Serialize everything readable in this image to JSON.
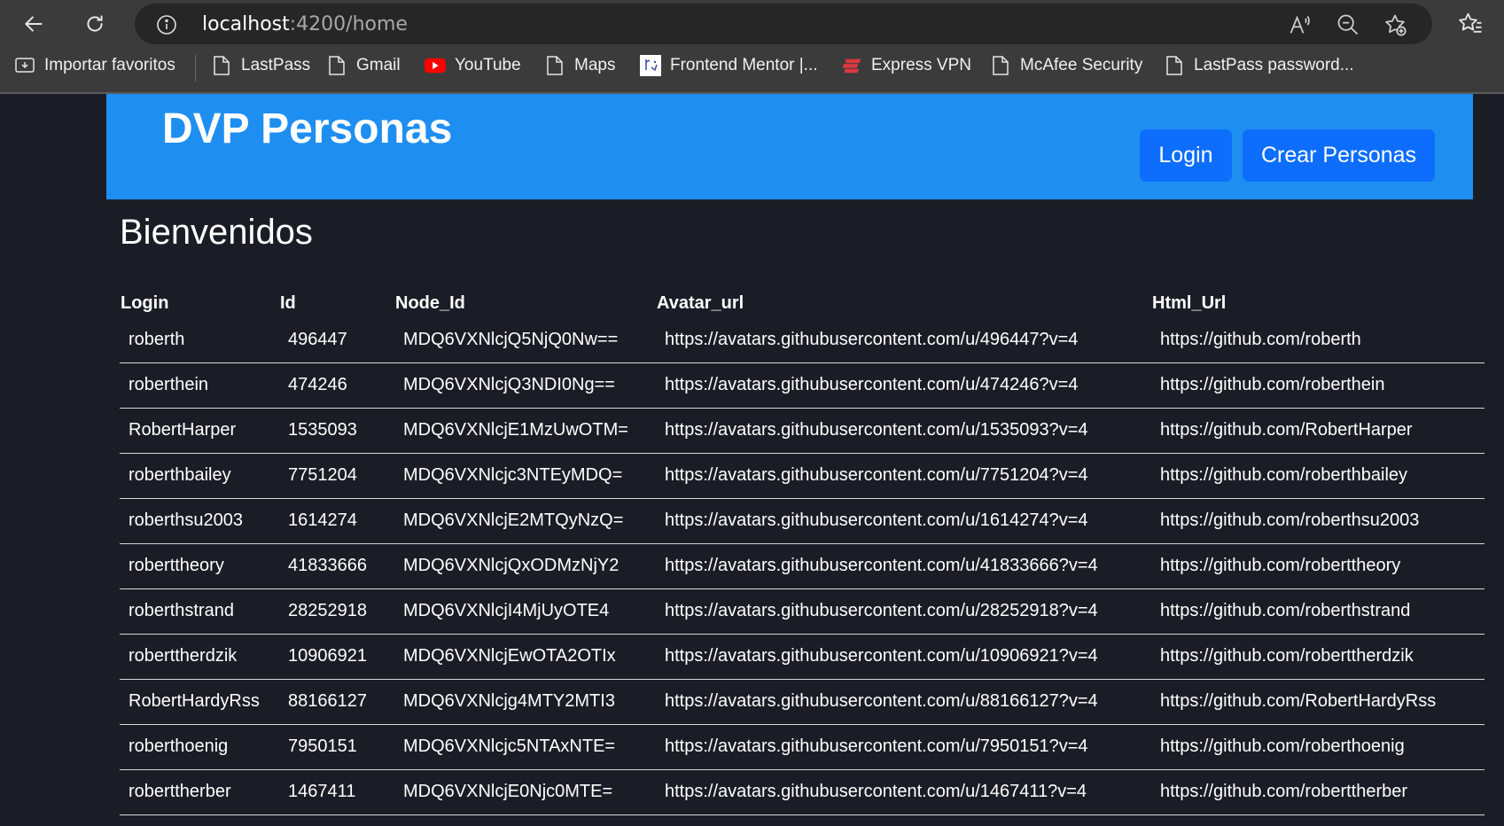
{
  "browser": {
    "url_host": "localhost",
    "url_path": ":4200/home",
    "bookmarks": [
      {
        "label": "Importar favoritos",
        "icon": "import-favorites-icon"
      },
      {
        "label": "LastPass",
        "icon": "page-icon"
      },
      {
        "label": "Gmail",
        "icon": "page-icon"
      },
      {
        "label": "YouTube",
        "icon": "youtube-icon"
      },
      {
        "label": "Maps",
        "icon": "page-icon"
      },
      {
        "label": "Frontend Mentor |...",
        "icon": "frontend-mentor-icon"
      },
      {
        "label": "Express VPN",
        "icon": "expressvpn-icon"
      },
      {
        "label": "McAfee Security",
        "icon": "page-icon"
      },
      {
        "label": "LastPass password...",
        "icon": "page-icon"
      }
    ]
  },
  "header": {
    "brand": "DVP Personas",
    "login_label": "Login",
    "crear_label": "Crear Personas"
  },
  "main": {
    "welcome": "Bienvenidos",
    "table": {
      "columns": [
        "Login",
        "Id",
        "Node_Id",
        "Avatar_url",
        "Html_Url"
      ],
      "rows": [
        [
          "roberth",
          "496447",
          "MDQ6VXNlcjQ5NjQ0Nw==",
          "https://avatars.githubusercontent.com/u/496447?v=4",
          "https://github.com/roberth"
        ],
        [
          "roberthein",
          "474246",
          "MDQ6VXNlcjQ3NDI0Ng==",
          "https://avatars.githubusercontent.com/u/474246?v=4",
          "https://github.com/roberthein"
        ],
        [
          "RobertHarper",
          "1535093",
          "MDQ6VXNlcjE1MzUwOTM=",
          "https://avatars.githubusercontent.com/u/1535093?v=4",
          "https://github.com/RobertHarper"
        ],
        [
          "roberthbailey",
          "7751204",
          "MDQ6VXNlcjc3NTEyMDQ=",
          "https://avatars.githubusercontent.com/u/7751204?v=4",
          "https://github.com/roberthbailey"
        ],
        [
          "roberthsu2003",
          "1614274",
          "MDQ6VXNlcjE2MTQyNzQ=",
          "https://avatars.githubusercontent.com/u/1614274?v=4",
          "https://github.com/roberthsu2003"
        ],
        [
          "roberttheory",
          "41833666",
          "MDQ6VXNlcjQxODMzNjY2",
          "https://avatars.githubusercontent.com/u/41833666?v=4",
          "https://github.com/roberttheory"
        ],
        [
          "roberthstrand",
          "28252918",
          "MDQ6VXNlcjI4MjUyOTE4",
          "https://avatars.githubusercontent.com/u/28252918?v=4",
          "https://github.com/roberthstrand"
        ],
        [
          "roberttherdzik",
          "10906921",
          "MDQ6VXNlcjEwOTA2OTIx",
          "https://avatars.githubusercontent.com/u/10906921?v=4",
          "https://github.com/roberttherdzik"
        ],
        [
          "RobertHardyRss",
          "88166127",
          "MDQ6VXNlcjg4MTY2MTI3",
          "https://avatars.githubusercontent.com/u/88166127?v=4",
          "https://github.com/RobertHardyRss"
        ],
        [
          "roberthoenig",
          "7950151",
          "MDQ6VXNlcjc5NTAxNTE=",
          "https://avatars.githubusercontent.com/u/7950151?v=4",
          "https://github.com/roberthoenig"
        ],
        [
          "roberttherber",
          "1467411",
          "MDQ6VXNlcjE0Njc0MTE=",
          "https://avatars.githubusercontent.com/u/1467411?v=4",
          "https://github.com/roberttherber"
        ]
      ]
    }
  },
  "colors": {
    "header_bg": "#1f8ef1",
    "button_bg": "#0d6efd",
    "page_bg": "#1b1d26"
  }
}
